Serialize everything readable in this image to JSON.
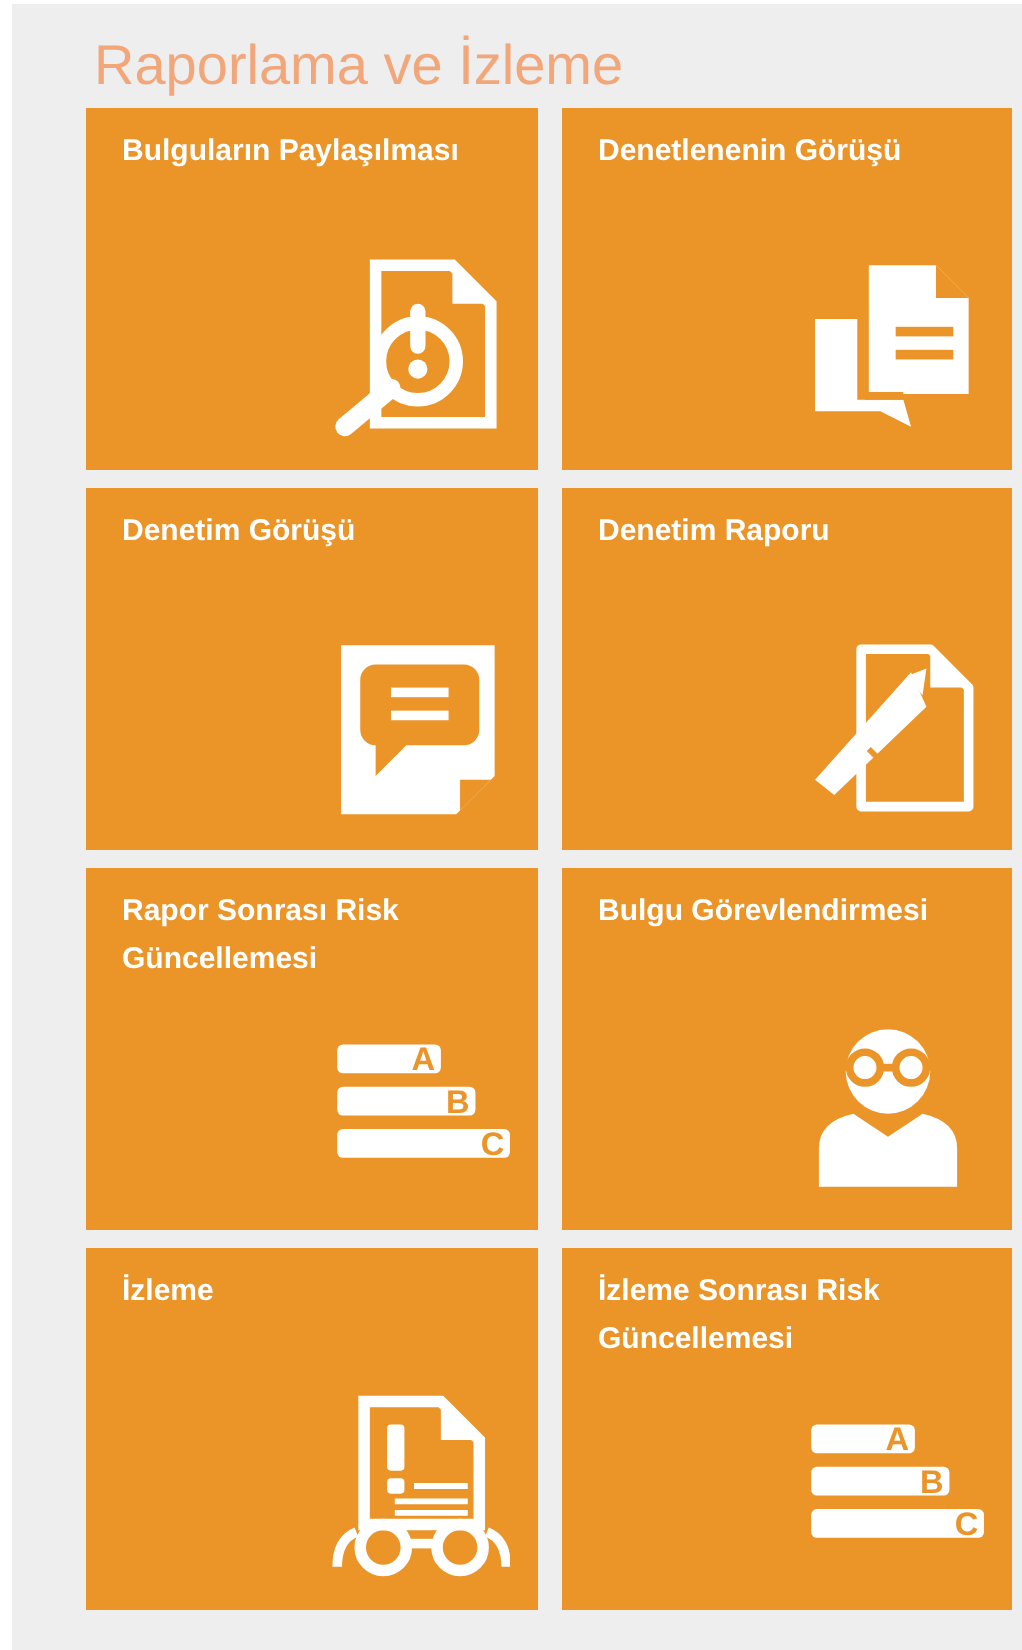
{
  "section_title": "Raporlama ve İzleme",
  "tiles": [
    {
      "label": "Bulguların Paylaşılması",
      "kind": "findings"
    },
    {
      "label": "Denetlenenin Görüşü",
      "kind": "feedback"
    },
    {
      "label": "Denetim Görüşü",
      "kind": "opinion"
    },
    {
      "label": "Denetim Raporu",
      "kind": "report"
    },
    {
      "label": "Rapor Sonrası Risk Güncellemesi",
      "kind": "risk",
      "grades": [
        "A",
        "B",
        "C"
      ]
    },
    {
      "label": "Bulgu Görevlendirmesi",
      "kind": "assign"
    },
    {
      "label": "İzleme",
      "kind": "monitor"
    },
    {
      "label": "İzleme Sonrası Risk Güncellemesi",
      "kind": "risk",
      "grades": [
        "A",
        "B",
        "C"
      ]
    }
  ]
}
